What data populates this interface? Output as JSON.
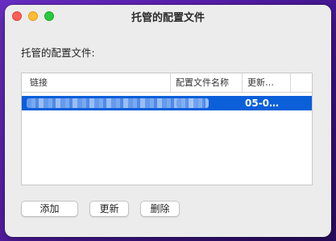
{
  "window": {
    "title": "托管的配置文件"
  },
  "section_label": "托管的配置文件:",
  "table": {
    "columns": [
      "链接",
      "配置文件名称",
      "更新…",
      ""
    ],
    "rows": [
      {
        "link": "",
        "name": "",
        "updated": "05-0…",
        "selected": true
      }
    ]
  },
  "buttons": {
    "add": "添加",
    "update": "更新",
    "delete": "删除"
  },
  "colors": {
    "selection": "#0b5fd9",
    "close": "#ff5f57",
    "minimize": "#febc2e",
    "maximize": "#28c840"
  }
}
